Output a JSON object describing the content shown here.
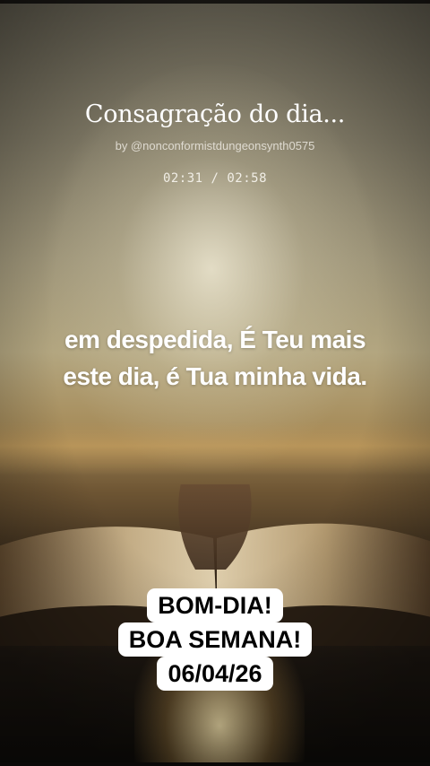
{
  "video": {
    "title": "Consagração do dia...",
    "byline": "by @nonconformistdungeonsynth0575",
    "timer": "02:31 / 02:58"
  },
  "lyrics": {
    "line1": "em despedida, É Teu mais",
    "line2": "este dia, é Tua minha vida."
  },
  "caption": {
    "line1": "BOM-DIA!",
    "line2": "BOA SEMANA!",
    "line3": "06/04/26"
  }
}
